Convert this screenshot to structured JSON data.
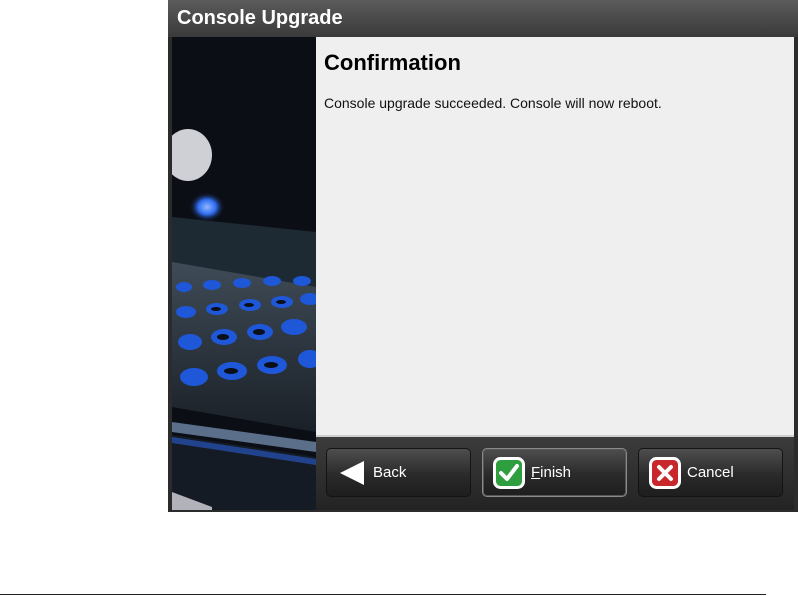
{
  "window": {
    "title": "Console Upgrade"
  },
  "content": {
    "heading": "Confirmation",
    "message": "Console upgrade succeeded. Console will now reboot."
  },
  "buttons": {
    "back": {
      "label": "Back",
      "icon": "back-arrow-icon"
    },
    "finish": {
      "mnemonic": "F",
      "label_rest": "inish",
      "icon": "check-icon"
    },
    "cancel": {
      "label": "Cancel",
      "icon": "close-x-icon"
    }
  },
  "colors": {
    "accent_green": "#2e9e3e",
    "accent_red": "#c8282b",
    "title_bar": "#4a4a4a",
    "content_bg": "#efefef"
  }
}
